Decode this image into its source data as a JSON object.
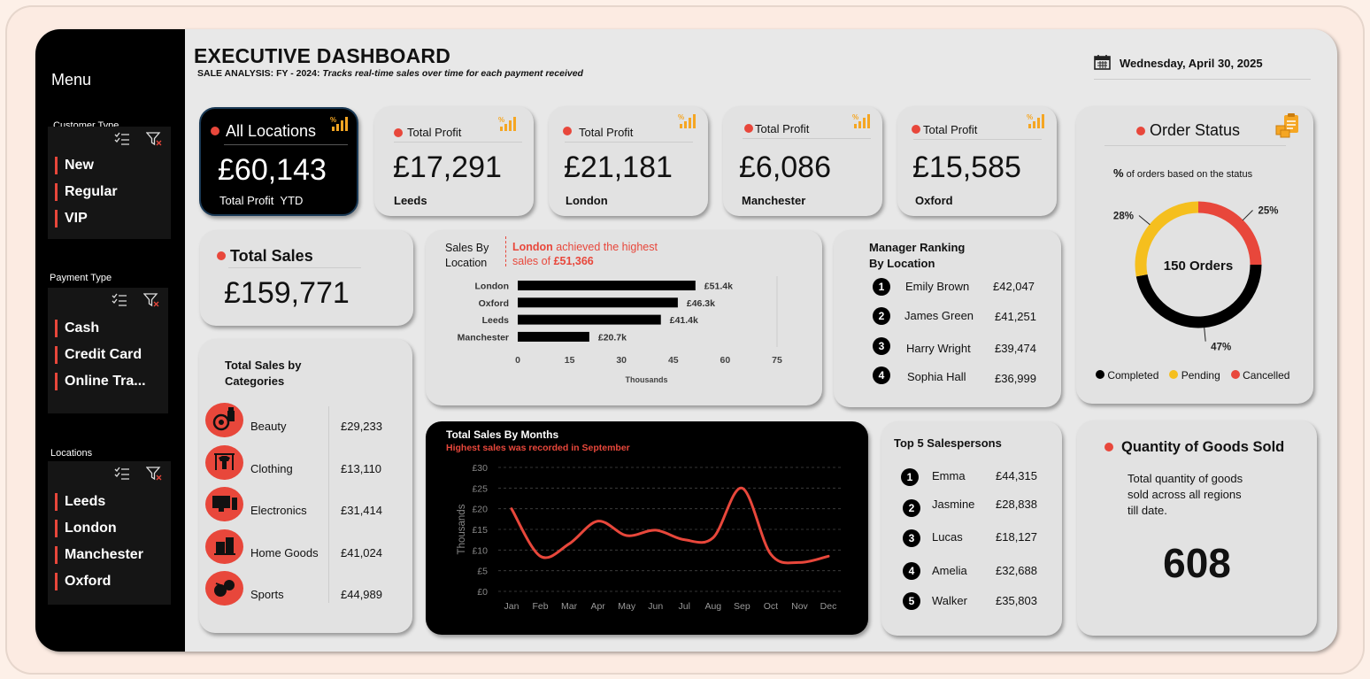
{
  "sidebar": {
    "title": "Menu",
    "customer_type": {
      "label": "Customer Type",
      "items": [
        "New",
        "Regular",
        "VIP"
      ]
    },
    "payment_type": {
      "label": "Payment Type",
      "items": [
        "Cash",
        "Credit Card",
        "Online Tra..."
      ]
    },
    "locations": {
      "label": "Locations",
      "items": [
        "Leeds",
        "London",
        "Manchester",
        "Oxford"
      ]
    }
  },
  "header": {
    "title": "EXECUTIVE DASHBOARD",
    "subtitle_bold": "SALE ANALYSIS: FY - 2024:",
    "subtitle_italic": "Tracks real-time sales over time for each payment received",
    "date": "Wednesday, April 30, 2025",
    "calendar_icon": "calendar-icon"
  },
  "kpis": {
    "all": {
      "title": "All Locations",
      "value": "£60,143",
      "caption": "Total Profit  YTD"
    },
    "leeds": {
      "title": "Total Profit",
      "value": "£17,291",
      "caption": "Leeds"
    },
    "london": {
      "title": "Total Profit",
      "value": "£21,181",
      "caption": "London"
    },
    "manchester": {
      "title": "Total Profit",
      "value": "£6,086",
      "caption": "Manchester"
    },
    "oxford": {
      "title": "Total Profit",
      "value": "£15,585",
      "caption": "Oxford"
    }
  },
  "total_sales": {
    "title": "Total Sales",
    "value": "£159,771"
  },
  "categories": {
    "title_line1": "Total Sales by",
    "title_line2": "Categories",
    "rows": [
      {
        "name": "Beauty",
        "value": "£29,233",
        "icon": "beauty-icon"
      },
      {
        "name": "Clothing",
        "value": "£13,110",
        "icon": "clothing-icon"
      },
      {
        "name": "Electronics",
        "value": "£31,414",
        "icon": "electronics-icon"
      },
      {
        "name": "Home Goods",
        "value": "£41,024",
        "icon": "home-goods-icon"
      },
      {
        "name": "Sports",
        "value": "£44,989",
        "icon": "sports-icon"
      }
    ]
  },
  "location_chart": {
    "title_line1": "Sales By",
    "title_line2": "Location",
    "note_city": "London",
    "note_text": " achieved the highest",
    "note_line2": "sales of ",
    "note_value": "£51,366"
  },
  "managers": {
    "title_line1": "Manager Ranking",
    "title_line2": "By Location",
    "rows": [
      {
        "rank": "1",
        "name": "Emily Brown",
        "value": "£42,047"
      },
      {
        "rank": "2",
        "name": "James Green",
        "value": "£41,251"
      },
      {
        "rank": "3",
        "name": "Harry Wright",
        "value": "£39,474"
      },
      {
        "rank": "4",
        "name": "Sophia Hall",
        "value": "£36,999"
      }
    ]
  },
  "order_status": {
    "title": "Order Status",
    "subtitle_pct": "%",
    "subtitle": " of orders based on the status",
    "center": "150 Orders",
    "legend": [
      {
        "label": "Completed",
        "color": "#000000"
      },
      {
        "label": "Pending",
        "color": "#f5bf1e"
      },
      {
        "label": "Cancelled",
        "color": "#e8473b"
      }
    ]
  },
  "months_chart": {
    "title": "Total Sales By Months",
    "subtitle": "Highest sales was recorded in September"
  },
  "salespersons": {
    "title": "Top 5 Salespersons",
    "rows": [
      {
        "rank": "1",
        "name": "Emma",
        "value": "£44,315"
      },
      {
        "rank": "2",
        "name": "Jasmine",
        "value": "£28,838"
      },
      {
        "rank": "3",
        "name": "Lucas",
        "value": "£18,127"
      },
      {
        "rank": "4",
        "name": "Amelia",
        "value": "£32,688"
      },
      {
        "rank": "5",
        "name": "Walker",
        "value": "£35,803"
      }
    ]
  },
  "goods": {
    "title": "Quantity of Goods Sold",
    "desc_line1": "Total quantity of goods",
    "desc_line2": "sold across all regions",
    "desc_line3": "till date.",
    "value": "608"
  },
  "colors": {
    "accent": "#e8473b",
    "pending": "#f5bf1e",
    "dark": "#000000",
    "card": "#e2e2e2"
  },
  "chart_data": [
    {
      "type": "bar",
      "orientation": "horizontal",
      "categories": [
        "London",
        "Oxford",
        "Leeds",
        "Manchester"
      ],
      "values": [
        51.4,
        46.3,
        41.4,
        20.7
      ],
      "data_labels": [
        "£51.4k",
        "£46.3k",
        "£41.4k",
        "£20.7k"
      ],
      "xlabel": "Thousands",
      "xticks": [
        "0",
        "15",
        "30",
        "45",
        "60",
        "75"
      ],
      "xlim": [
        0,
        75
      ],
      "grid": false
    },
    {
      "type": "line",
      "x": [
        "Jan",
        "Feb",
        "Mar",
        "Apr",
        "May",
        "Jun",
        "Jul",
        "Aug",
        "Sep",
        "Oct",
        "Nov",
        "Dec"
      ],
      "values": [
        20,
        8.5,
        11.5,
        17,
        13.5,
        14.8,
        12.5,
        13,
        25,
        9,
        7,
        8.5
      ],
      "ylabel": "Thousands",
      "yticks": [
        "£0",
        "£5",
        "£10",
        "£15",
        "£20",
        "£25",
        "£30"
      ],
      "ylim": [
        0,
        30
      ],
      "grid": true,
      "color": "#e8473b"
    },
    {
      "type": "pie",
      "variant": "donut",
      "labels": [
        "Cancelled",
        "Completed",
        "Pending"
      ],
      "values": [
        25,
        47,
        28
      ],
      "data_labels": [
        "25%",
        "47%",
        "28%"
      ],
      "colors": [
        "#e8473b",
        "#000000",
        "#f5bf1e"
      ]
    }
  ]
}
